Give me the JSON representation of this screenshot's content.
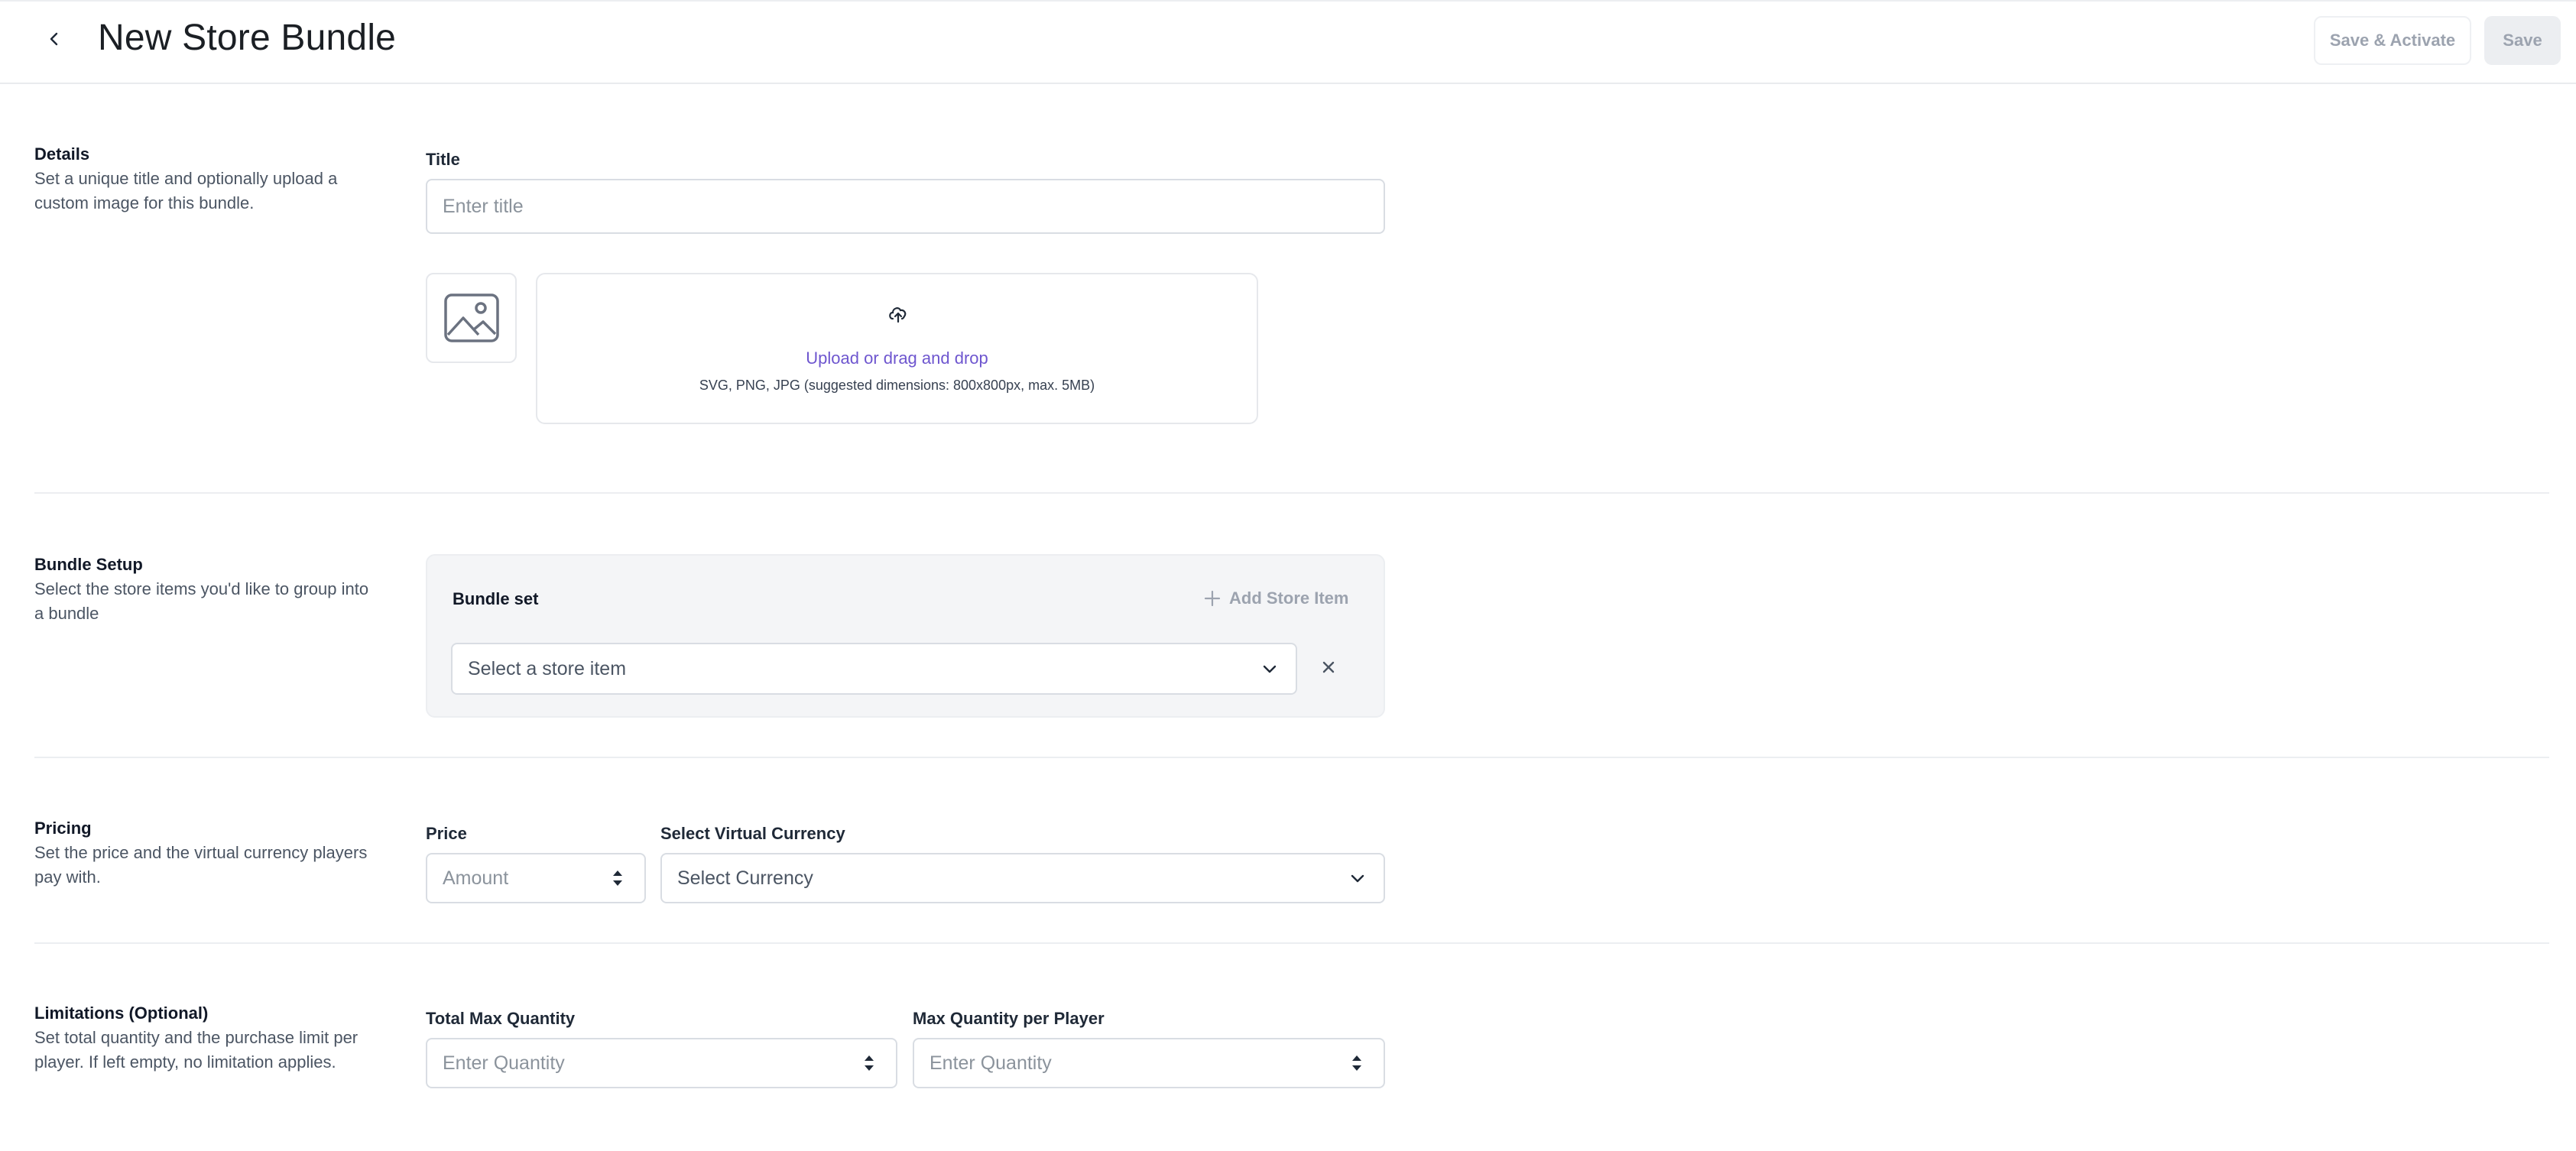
{
  "header": {
    "title": "New Store Bundle",
    "save_activate_label": "Save & Activate",
    "save_label": "Save"
  },
  "details": {
    "title": "Details",
    "description": "Set a unique title and optionally upload a custom image for this bundle.",
    "title_field_label": "Title",
    "title_placeholder": "Enter title",
    "upload_link": "Upload or drag and drop",
    "upload_hint": "SVG, PNG, JPG (suggested dimensions: 800x800px, max. 5MB)"
  },
  "bundle_setup": {
    "title": "Bundle Setup",
    "description": "Select the store items you'd like to group into a bundle",
    "set_label": "Bundle set",
    "add_item_label": "Add Store Item",
    "select_placeholder": "Select a store item"
  },
  "pricing": {
    "title": "Pricing",
    "description": "Set the price and the virtual currency players pay with.",
    "price_label": "Price",
    "price_placeholder": "Amount",
    "currency_label": "Select Virtual Currency",
    "currency_placeholder": "Select Currency"
  },
  "limitations": {
    "title": "Limitations (Optional)",
    "description": "Set total quantity and the purchase limit per player. If left empty, no limitation applies.",
    "total_label": "Total Max Quantity",
    "total_placeholder": "Enter Quantity",
    "per_player_label": "Max Quantity per Player",
    "per_player_placeholder": "Enter Quantity"
  },
  "colors": {
    "accent": "#6e56cf",
    "border": "#d9dde3",
    "muted_text": "#9ca3af"
  },
  "icons": [
    "chevron-left-icon",
    "image-placeholder-icon",
    "cloud-upload-icon",
    "plus-icon",
    "chevron-down-icon",
    "close-icon",
    "spinner-arrows-icon"
  ]
}
